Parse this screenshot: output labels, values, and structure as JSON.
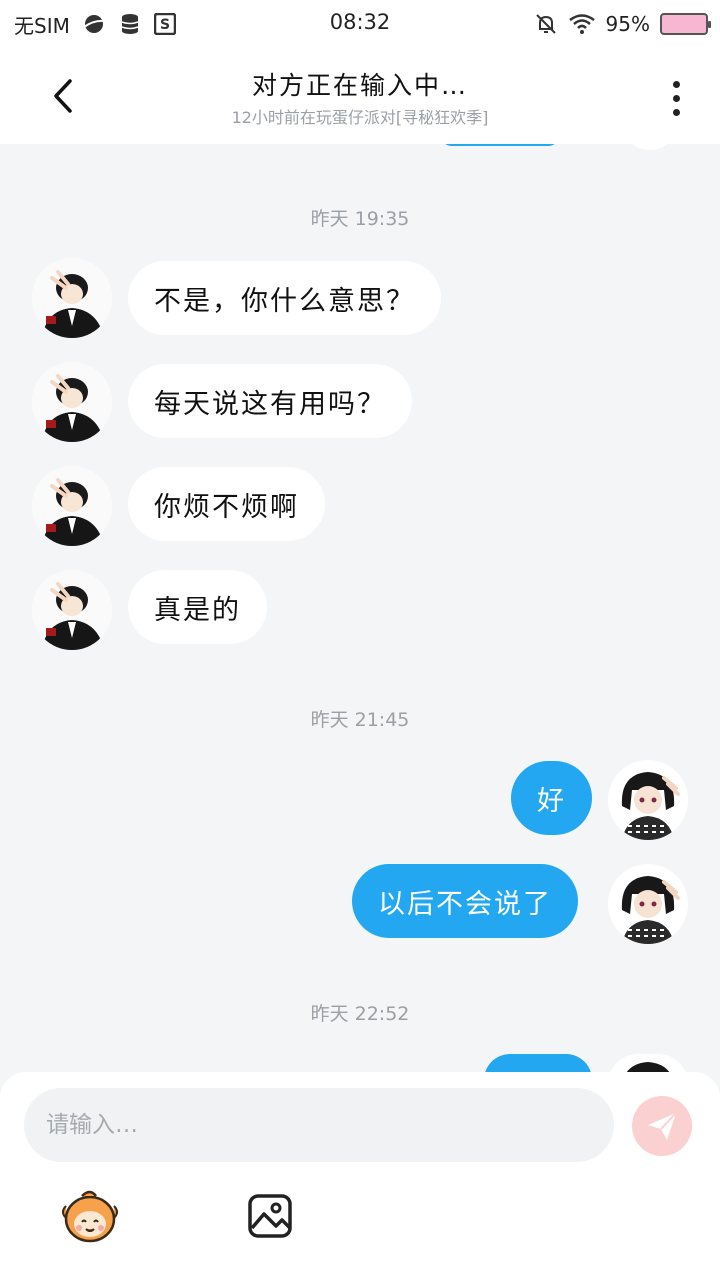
{
  "status_bar": {
    "sim": "无SIM",
    "time": "08:32",
    "battery": "95%"
  },
  "header": {
    "title": "对方正在输入中…",
    "subtitle": "12小时前在玩蛋仔派对[寻秘狂欢季]"
  },
  "chat": {
    "groups": [
      {
        "timestamp": "昨天 19:35",
        "messages": [
          {
            "side": "in",
            "text": "不是，你什么意思？"
          },
          {
            "side": "in",
            "text": "每天说这有用吗？"
          },
          {
            "side": "in",
            "text": "你烦不烦啊"
          },
          {
            "side": "in",
            "text": "真是的"
          }
        ]
      },
      {
        "timestamp": "昨天 21:45",
        "messages": [
          {
            "side": "out",
            "text": "好"
          },
          {
            "side": "out",
            "text": "以后不会说了"
          }
        ]
      },
      {
        "timestamp": "昨天 22:52",
        "messages": []
      }
    ]
  },
  "composer": {
    "placeholder": "请输入…",
    "send_icon": "send-icon",
    "emoji_icon": "emoji-face-icon",
    "image_icon": "image-icon"
  },
  "colors": {
    "accent": "#22a7f0",
    "background": "#f3f5f7",
    "send_disabled": "#fbd0d0"
  }
}
